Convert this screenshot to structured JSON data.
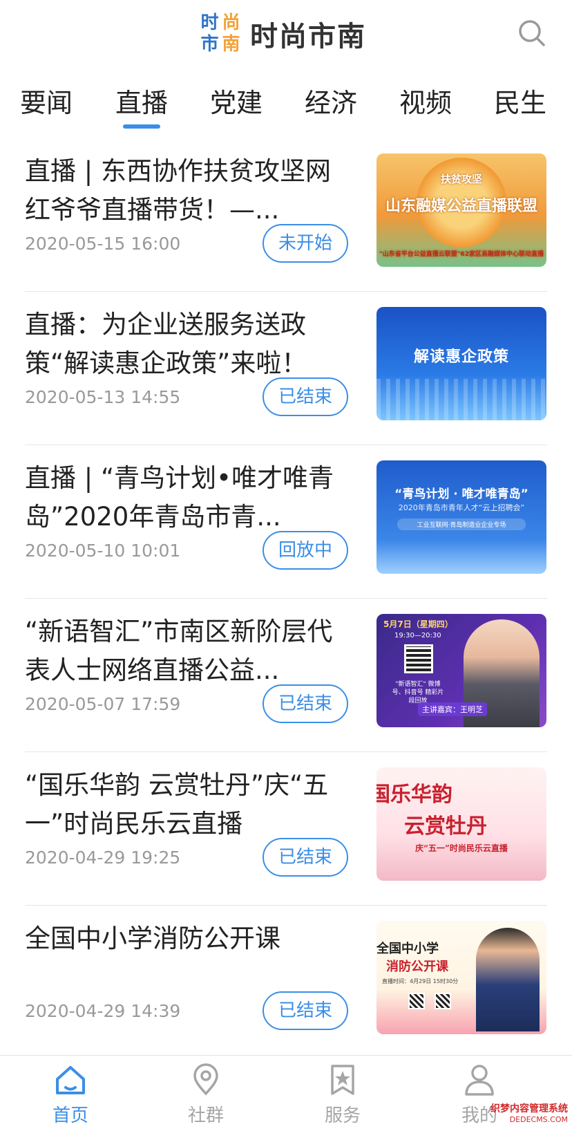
{
  "header": {
    "logo_chars": [
      "时",
      "尚",
      "市",
      "南"
    ],
    "app_name": "时尚市南",
    "search_icon": "search-icon"
  },
  "tabs": [
    {
      "label": "要闻"
    },
    {
      "label": "直播",
      "active": true
    },
    {
      "label": "党建"
    },
    {
      "label": "经济"
    },
    {
      "label": "视频"
    },
    {
      "label": "民生"
    }
  ],
  "items": [
    {
      "title": "直播 | 东西协作扶贫攻坚网红爷爷直播带货！—...",
      "time": "2020-05-15 16:00",
      "status": "未开始",
      "thumb": {
        "top": "扶贫攻坚",
        "caption": "山东融媒公益直播联盟",
        "bottom": "\"山东省平台公益直播云联盟\"62家区县融媒体中心联动直播"
      }
    },
    {
      "title": "直播：为企业送服务送政策“解读惠企政策”来啦！",
      "time": "2020-05-13 14:55",
      "status": "已结束",
      "thumb": {
        "caption": "解读惠企政策"
      }
    },
    {
      "title": "直播 | “青鸟计划•唯才唯青岛”2020年青岛市青...",
      "time": "2020-05-10 10:01",
      "status": "回放中",
      "thumb": {
        "caption": "“青鸟计划 · 唯才唯青岛”",
        "sub": "2020年青岛市青年人才“云上招聘会”",
        "band": "工业互联网·青岛制造业企业专场"
      }
    },
    {
      "title": "“新语智汇”市南区新阶层代表人士网络直播公益...",
      "time": "2020-05-07 17:59",
      "status": "已结束",
      "thumb": {
        "date": "5月7日（星期四）",
        "time": "19:30—20:30",
        "small": "\"新语智汇\" 微博号、抖音号 精彩片段回放",
        "speaker": "主讲嘉宾：王明芝"
      }
    },
    {
      "title": "“国乐华韵 云赏牡丹”庆“五一”时尚民乐云直播",
      "time": "2020-04-29 19:25",
      "status": "已结束",
      "thumb": {
        "l1": "国乐华韵",
        "l2": "云赏牡丹",
        "l3": "庆“五一”时尚民乐云直播"
      }
    },
    {
      "title": "全国中小学消防公开课",
      "time": "2020-04-29 14:39",
      "status": "已结束",
      "thumb": {
        "l1": "全国中小学",
        "l2": "消防公开课",
        "info": "直播时间：4月29日 15时30分"
      }
    }
  ],
  "bottom_nav": [
    {
      "label": "首页",
      "icon": "home-icon",
      "active": true
    },
    {
      "label": "社群",
      "icon": "location-pin-icon"
    },
    {
      "label": "服务",
      "icon": "bookmark-star-icon"
    },
    {
      "label": "我的",
      "icon": "user-icon"
    }
  ],
  "watermark": {
    "line1": "织梦内容管理系统",
    "line2": "DEDECMS.COM"
  },
  "colors": {
    "accent": "#3a8ee6",
    "text": "#222222",
    "muted": "#999999",
    "divider": "#e6e6e6"
  }
}
